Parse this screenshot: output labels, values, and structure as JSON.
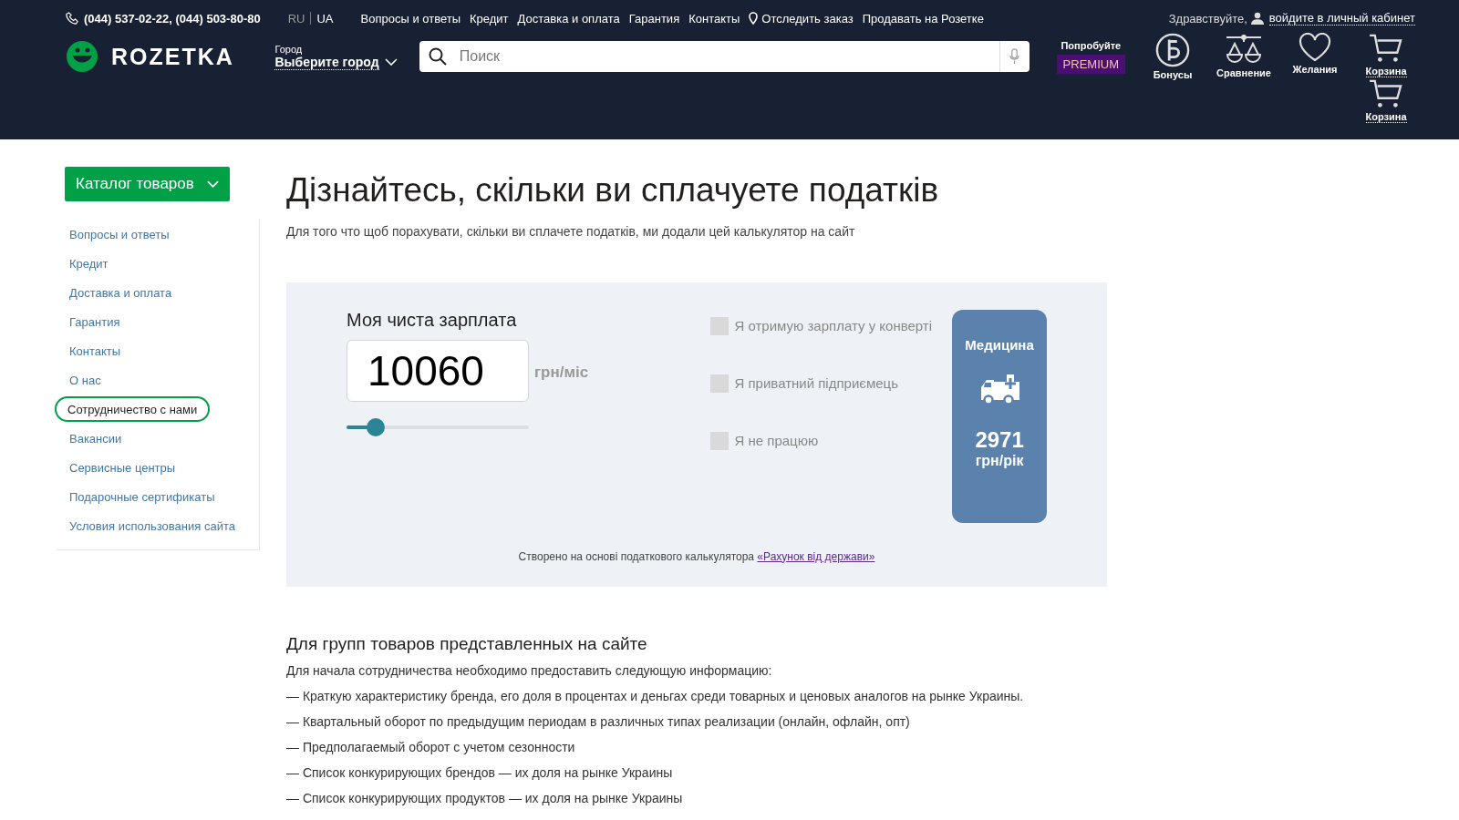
{
  "header": {
    "phones": "(044) 537-02-22, (044) 503-80-80",
    "languages": [
      {
        "label": "RU",
        "selected": false
      },
      {
        "label": "UA",
        "selected": true
      }
    ],
    "top_links": [
      "Вопросы и ответы",
      "Кредит",
      "Доставка и оплата",
      "Гарантия",
      "Контакты",
      "Отследить заказ",
      "Продавать на Розетке"
    ],
    "greeting": "Здравствуйте,",
    "login_link": "войдите в личный кабинет",
    "logo": "ROZETKA",
    "city_label": "Город",
    "city_value": "Выберите город",
    "search": {
      "placeholder": "Поиск"
    },
    "premium": {
      "caption": "Попробуйте",
      "badge": "PREMIUM"
    },
    "actions": [
      {
        "kind": "bonus",
        "label": "Бонусы"
      },
      {
        "kind": "compare",
        "label": "Сравнение"
      },
      {
        "kind": "wishlist",
        "label": "Желания"
      },
      {
        "kind": "cart",
        "label": "Корзина"
      }
    ],
    "extra_cart": "Корзина"
  },
  "catalog_button": "Каталог товаров",
  "sidebar": {
    "items": [
      {
        "label": "Вопросы и ответы",
        "selected": false
      },
      {
        "label": "Кредит",
        "selected": false
      },
      {
        "label": "Доставка и оплата",
        "selected": false
      },
      {
        "label": "Гарантия",
        "selected": false
      },
      {
        "label": "Контакты",
        "selected": false
      },
      {
        "label": "О нас",
        "selected": false
      },
      {
        "label": "Сотрудничество с нами",
        "selected": true
      },
      {
        "label": "Вакансии",
        "selected": false
      },
      {
        "label": "Сервисные центры",
        "selected": false
      },
      {
        "label": "Подарочные сертификаты",
        "selected": false
      },
      {
        "label": "Условия использования сайта",
        "selected": false
      }
    ]
  },
  "title": "Дізнайтесь, скільки ви сплачуете податків",
  "subtitle": "Для того что щоб порахувати, скільки ви сплачете податків, ми додали цей калькулятор на сайт",
  "calculator": {
    "salary_label": "Моя чиста зарплата",
    "salary_value": "10060",
    "unit": "грн/міс",
    "slider": {
      "level": 0.16
    },
    "options": [
      {
        "label": "Я отримую зарплату у конверті",
        "checked": false
      },
      {
        "label": "Я приватний підприємець",
        "checked": false
      },
      {
        "label": "Я не працюю",
        "checked": false
      }
    ],
    "card": {
      "title": "Медицина",
      "amount": "2971",
      "unit": "грн/рік"
    },
    "footnote": "Створено на основі податкового калькулятора",
    "footnote_link": "«Рахунок від держави»"
  },
  "section": {
    "heading": "Для групп товаров представленных на сайте",
    "intro": "Для начала сотрудничества необходимо предоставить следующую информацию:",
    "items": [
      "— Краткую характеристику бренда, его доля в процентах и деньгах среди товарных и ценовых аналогов на рынке Украины.",
      "— Квартальный оборот по предыдущим периодам в различных типах реализации (онлайн, офлайн, опт)",
      "— Предполагаемый оборот с учетом сезонности",
      "— Список конкурирующих брендов — их доля на рынке Украины",
      "— Список конкурирующих продуктов — их доля на рынке Украины"
    ]
  }
}
